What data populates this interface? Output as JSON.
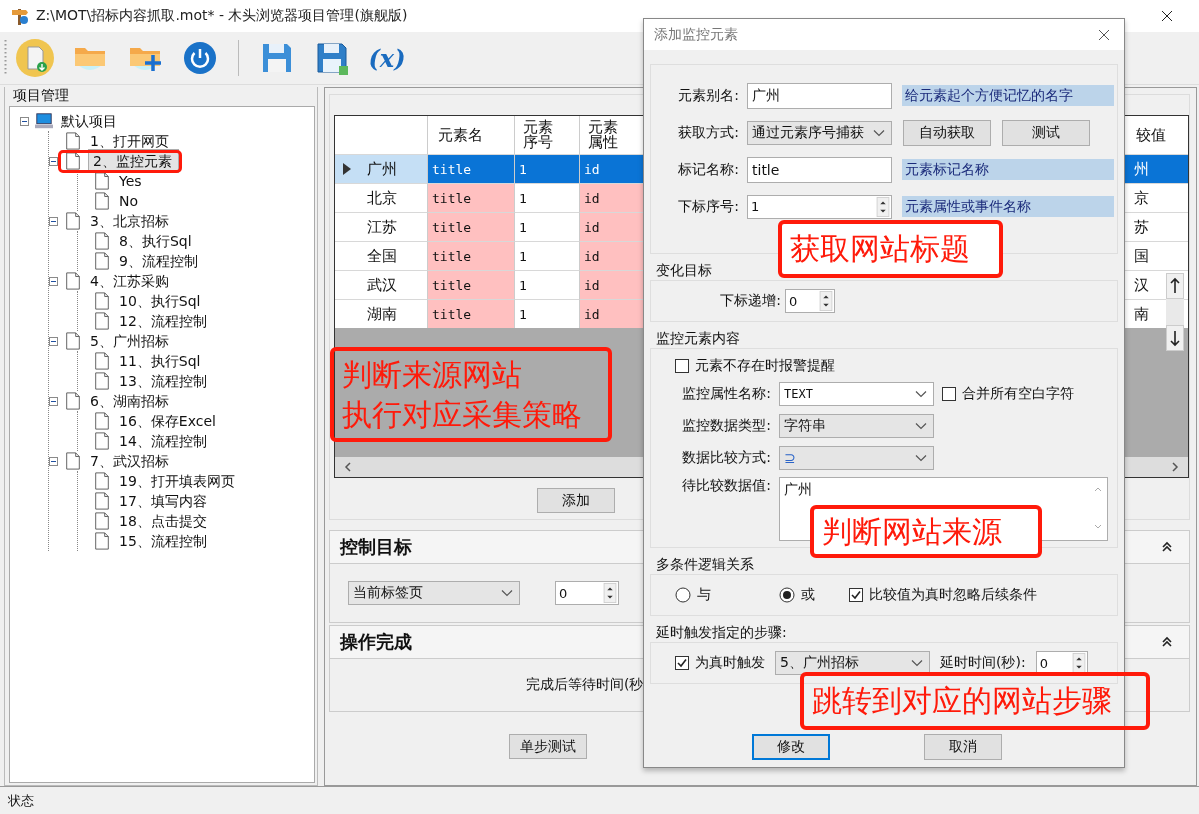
{
  "window": {
    "title": "Z:\\MOT\\招标内容抓取.mot* - 木头浏览器项目管理(旗舰版)"
  },
  "toolbar": [
    {
      "kind": "new"
    },
    {
      "kind": "open"
    },
    {
      "kind": "add"
    },
    {
      "kind": "power"
    },
    {
      "kind": "separator"
    },
    {
      "kind": "save"
    },
    {
      "kind": "save-as"
    },
    {
      "kind": "variable",
      "label": "(x)"
    }
  ],
  "project_panel": {
    "title": "项目管理",
    "tree": [
      {
        "label": "默认项目",
        "kind": "project",
        "expanded": true,
        "selected": false,
        "children": [
          {
            "label": "1、打开网页",
            "selected": false
          },
          {
            "label": "2、监控元素",
            "selected": true,
            "expanded": true,
            "children": [
              {
                "label": "Yes",
                "selected": false
              },
              {
                "label": "No",
                "selected": false
              }
            ]
          },
          {
            "label": "3、北京招标",
            "selected": false,
            "expanded": true,
            "children": [
              {
                "label": "8、执行Sql",
                "selected": false
              },
              {
                "label": "9、流程控制",
                "selected": false
              }
            ]
          },
          {
            "label": "4、江苏采购",
            "selected": false,
            "expanded": true,
            "children": [
              {
                "label": "10、执行Sql",
                "selected": false
              },
              {
                "label": "12、流程控制",
                "selected": false
              }
            ]
          },
          {
            "label": "5、广州招标",
            "selected": false,
            "expanded": true,
            "children": [
              {
                "label": "11、执行Sql",
                "selected": false
              },
              {
                "label": "13、流程控制",
                "selected": false
              }
            ]
          },
          {
            "label": "6、湖南招标",
            "selected": false,
            "expanded": true,
            "children": [
              {
                "label": "16、保存Excel",
                "selected": false
              },
              {
                "label": "14、流程控制",
                "selected": false
              }
            ]
          },
          {
            "label": "7、武汉招标",
            "selected": false,
            "expanded": true,
            "children": [
              {
                "label": "19、打开填表网页",
                "selected": false
              },
              {
                "label": "17、填写内容",
                "selected": false
              },
              {
                "label": "18、点击提交",
                "selected": false
              },
              {
                "label": "15、流程控制",
                "selected": false
              }
            ]
          }
        ]
      }
    ]
  },
  "step_table": {
    "columns": [
      {
        "label": "元素名"
      },
      {
        "label": "元素序号"
      },
      {
        "label": "元素属性"
      },
      {
        "label": "较值"
      }
    ],
    "rows": [
      {
        "name": "广州",
        "cells": [
          "title",
          "1",
          "id",
          "州"
        ],
        "selected": true
      },
      {
        "name": "北京",
        "cells": [
          "title",
          "1",
          "id",
          "京"
        ],
        "selected": false
      },
      {
        "name": "江苏",
        "cells": [
          "title",
          "1",
          "id",
          "苏"
        ],
        "selected": false
      },
      {
        "name": "全国",
        "cells": [
          "title",
          "1",
          "id",
          "国"
        ],
        "selected": false
      },
      {
        "name": "武汉",
        "cells": [
          "title",
          "1",
          "id",
          "汉"
        ],
        "selected": false
      },
      {
        "name": "湖南",
        "cells": [
          "title",
          "1",
          "id",
          "南"
        ],
        "selected": false
      }
    ]
  },
  "add_button": "添加",
  "sections": [
    {
      "kind": "target",
      "title": "控制目标",
      "select": "当前标签页",
      "spin": "0"
    },
    {
      "kind": "done",
      "title": "操作完成",
      "text": "完成后等待时间(秒"
    }
  ],
  "test_button": "单步测试",
  "status_bar": "状态",
  "dialog": {
    "title": "添加监控元素",
    "fields": [
      {
        "kind": "input",
        "label": "元素别名:",
        "value": "广州",
        "hint": "给元素起个方便记忆的名字"
      },
      {
        "kind": "select",
        "label": "获取方式:",
        "value": "通过元素序号捕获",
        "buttons": [
          "自动获取",
          "测试"
        ]
      },
      {
        "kind": "input",
        "label": "标记名称:",
        "value": "title",
        "hint": "元素标记名称"
      },
      {
        "kind": "spin",
        "label": "下标序号:",
        "value": "1",
        "hint": "元素属性或事件名称"
      }
    ],
    "change_target": {
      "title": "变化目标",
      "label": "下标递增:",
      "value": "0"
    },
    "monitor": {
      "title": "监控元素内容",
      "alarm": {
        "label": "元素不存在时报警提醒",
        "checked": false
      },
      "attribute": {
        "label": "监控属性名称:",
        "value": "TEXT"
      },
      "merge": {
        "label": "合并所有空白字符",
        "checked": false
      },
      "data_type": {
        "label": "监控数据类型:",
        "value": "字符串"
      },
      "compare": {
        "label": "数据比较方式:",
        "value": "⊇"
      },
      "compare_value": {
        "label": "待比较数据值:",
        "value": "广州"
      }
    },
    "logic": {
      "title": "多条件逻辑关系",
      "options": [
        {
          "label": "与",
          "selected": false
        },
        {
          "label": "或",
          "selected": true
        }
      ],
      "skip": {
        "label": "比较值为真时忽略后续条件",
        "checked": true
      }
    },
    "delay": {
      "title": "延时触发指定的步骤:",
      "trigger": {
        "label": "为真时触发",
        "checked": true
      },
      "step": "5、广州招标",
      "time_label": "延时时间(秒):",
      "time": "0"
    },
    "buttons": [
      {
        "label": "修改",
        "focused": true
      },
      {
        "label": "取消",
        "focused": false
      }
    ]
  },
  "annotations": [
    {
      "kind": "frame"
    },
    {
      "kind": "label",
      "lines": [
        "判断来源网站",
        "执行对应采集策略"
      ]
    },
    {
      "kind": "label",
      "lines": [
        "获取网站标题"
      ]
    },
    {
      "kind": "label",
      "lines": [
        "判断网站来源"
      ]
    },
    {
      "kind": "label",
      "lines": [
        "跳转到对应的网站步骤"
      ]
    }
  ]
}
